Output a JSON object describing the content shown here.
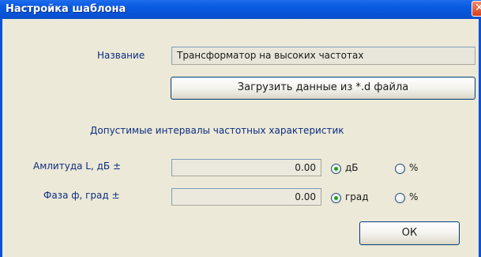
{
  "window": {
    "title": "Настройка шаблона",
    "close_glyph": "✕"
  },
  "form": {
    "name_label": "Название",
    "name_value": "Трансформатор на высоких частотах",
    "load_button_label": "Загрузить данные из *.d файла",
    "intervals_heading": "Допустимые интервалы частотных характеристик",
    "amplitude": {
      "label": "Амлитуда L, дБ ±",
      "value": "0.00",
      "option_unit_label": "дБ",
      "option_percent_label": "%",
      "selected": "дБ"
    },
    "phase": {
      "label": "Фаза ф, град ±",
      "value": "0.00",
      "option_unit_label": "град",
      "option_percent_label": "%",
      "selected": "град"
    },
    "ok_button_label": "ОК"
  },
  "colors": {
    "title_bar": "#0a5be0",
    "label_text": "#0c2d80",
    "dialog_background": "#ece9d8",
    "radio_dot": "#21a121"
  }
}
